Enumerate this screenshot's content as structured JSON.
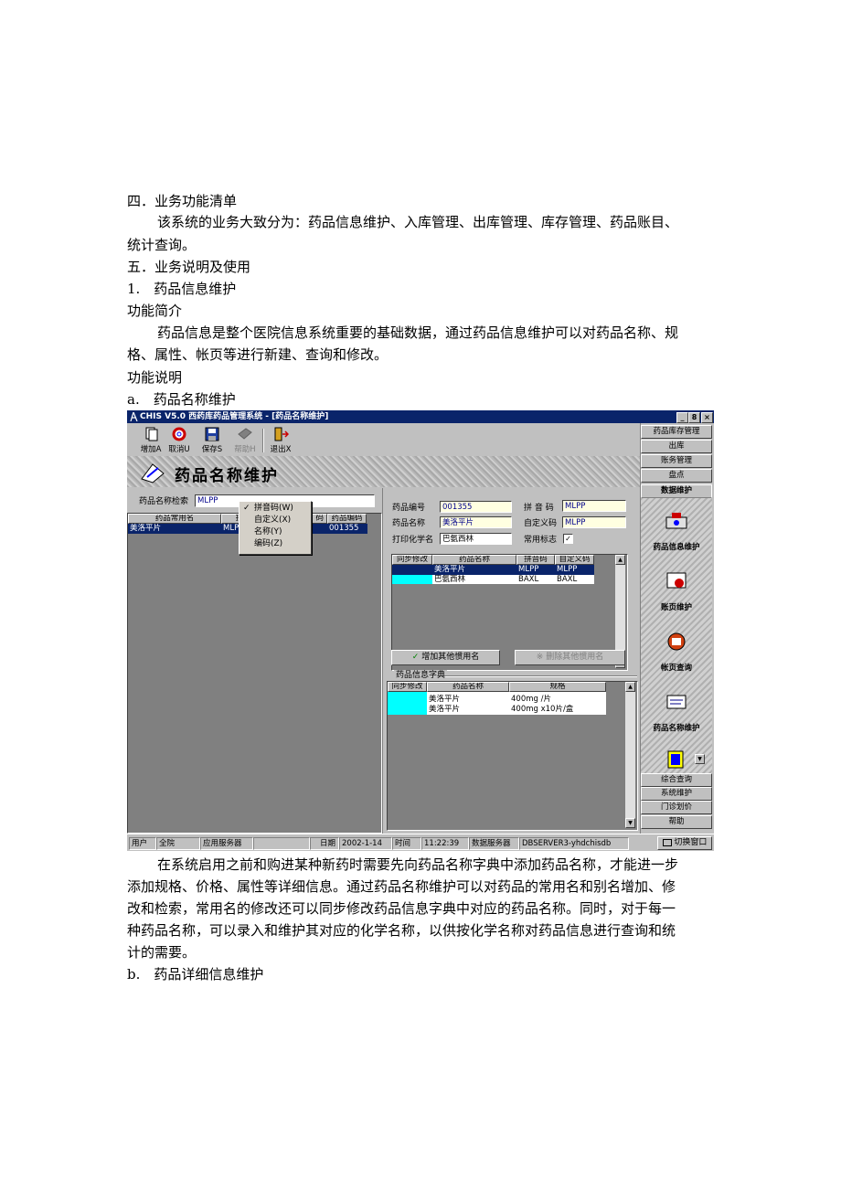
{
  "doc": {
    "h4": "四．业务功能清单",
    "p1": "该系统的业务大致分为：药品信息维护、入库管理、出库管理、库存管理、药品账目、",
    "p1b": "统计查询。",
    "h5": "五．业务说明及使用",
    "h51": "1.　药品信息维护",
    "intro_h": "功能简介",
    "intro_p1": "药品信息是整个医院信息系统重要的基础数据，通过药品信息维护可以对药品名称、规",
    "intro_p2": "格、属性、帐页等进行新建、查询和修改。",
    "desc_h": "功能说明",
    "sub_a": "a.　药品名称维护",
    "after_p1": "在系统启用之前和购进某种新药时需要先向药品名称字典中添加药品名称，才能进一步",
    "after_p2": "添加规格、价格、属性等详细信息。通过药品名称维护可以对药品的常用名和别名增加、修",
    "after_p3": "改和检索，常用名的修改还可以同步修改药品信息字典中对应的药品名称。同时，对于每一",
    "after_p4": "种药品名称，可以录入和维护其对应的化学名称，以供按化学名称对药品信息进行查询和统",
    "after_p5": "计的需要。",
    "sub_b": "b.　药品详细信息维护"
  },
  "window": {
    "title": "CHIS V5.0 西药库药品管理系统 - [药品名称维护]",
    "controls": [
      "_",
      "8",
      "×"
    ],
    "toolbar": [
      {
        "label": "增加A"
      },
      {
        "label": "取消U"
      },
      {
        "label": "保存S"
      },
      {
        "label": "帮助H"
      },
      {
        "label": "退出X"
      }
    ],
    "banner_title": "药品名称维护",
    "search_label": "药品名称检索",
    "search_value": "MLPP",
    "left_grid": {
      "headers": [
        "药品常用名",
        "拼",
        "码",
        "药品编码"
      ],
      "row": [
        "美洛平片",
        "MLPF",
        "",
        "001355"
      ]
    },
    "context_menu": [
      "拼音码(W)",
      "自定义(X)",
      "名称(Y)",
      "编码(Z)"
    ],
    "form": {
      "code_label": "药品编号",
      "code_value": "001355",
      "pinyin_label": "拼 音 码",
      "pinyin_value": "MLPP",
      "name_label": "药品名称",
      "name_value": "美洛平片",
      "custom_label": "自定义码",
      "custom_value": "MLPP",
      "chem_label": "打印化学名",
      "chem_value": "巴氨西林",
      "common_label": "常用标志",
      "common_check": "✓"
    },
    "alias_grid": {
      "headers": [
        "同步修改",
        "药品名称",
        "拼音码",
        "自定义码"
      ],
      "rows": [
        [
          "",
          "美洛平片",
          "MLPP",
          "MLPP"
        ],
        [
          "",
          "巴氨西林",
          "BAXL",
          "BAXL"
        ]
      ]
    },
    "btn_add_alias": "增加其他惯用名",
    "btn_del_alias": "删除其他惯用名",
    "dict_title": "药品信息字典",
    "dict_grid": {
      "headers": [
        "同步修改",
        "药品名称",
        "规格"
      ],
      "rows": [
        [
          "",
          "美洛平片",
          "400mg /片"
        ],
        [
          "",
          "美洛平片",
          "400mg x10片/盒"
        ]
      ]
    },
    "right_nav_top": [
      "药品库存管理",
      "出库",
      "账务管理",
      "盘点"
    ],
    "right_nav_active": "数据维护",
    "right_nav_icons": [
      "药品信息维护",
      "账页维护",
      "帐页查询",
      "药品名称维护"
    ],
    "right_nav_bottom": [
      "综合查询",
      "系统维护",
      "门诊划价",
      "帮助"
    ],
    "status": {
      "user_label": "用户",
      "user_value": "全院",
      "app_label": "应用服务器",
      "app_value": "",
      "date_label": "日期",
      "date_value": "2002-1-14",
      "time_label": "时间",
      "time_value": "11:22:39",
      "db_label": "数据服务器",
      "db_value": "DBSERVER3-yhdchisdb",
      "switch": "切换窗口"
    }
  }
}
